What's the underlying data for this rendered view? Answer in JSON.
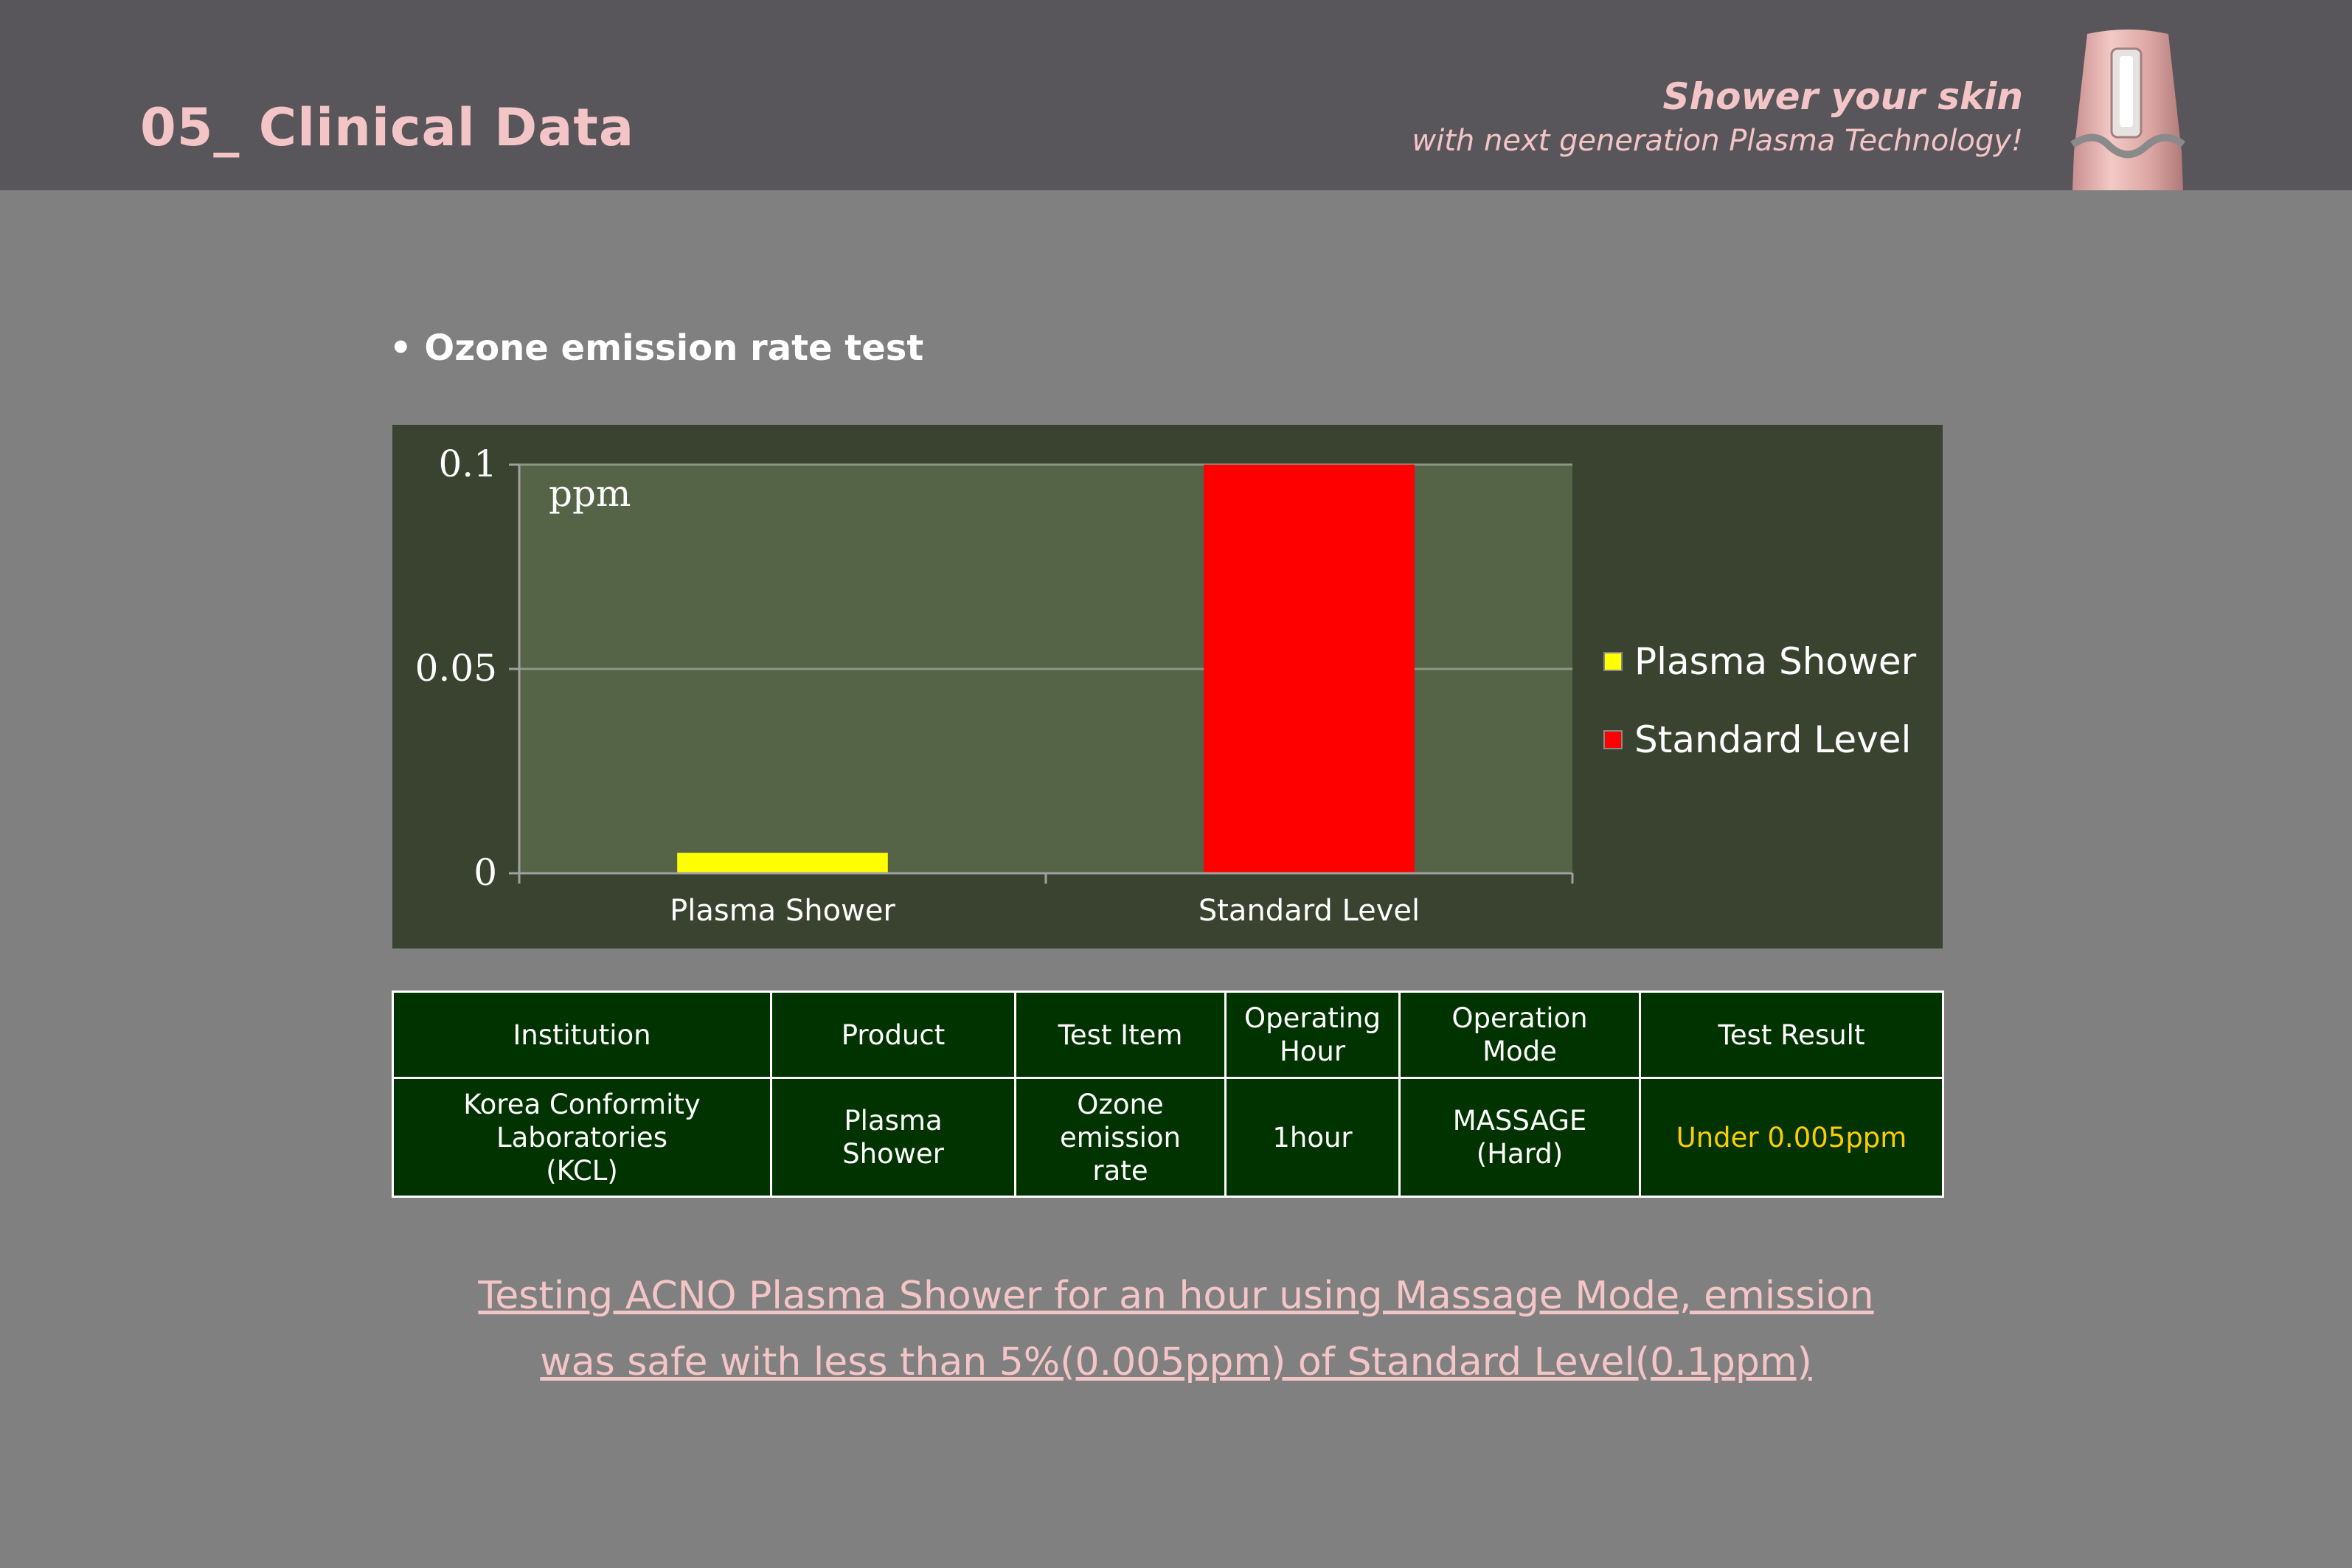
{
  "header": {
    "title": "05_ Clinical Data",
    "tagline_main": "Shower your skin",
    "tagline_sub": "with next generation Plasma Technology!"
  },
  "section_title": "• Ozone emission rate test",
  "chart_data": {
    "type": "bar",
    "categories": [
      "Plasma Shower",
      "Standard Level"
    ],
    "values": [
      0.005,
      0.1
    ],
    "colors": [
      "#ffff00",
      "#ff0000"
    ],
    "yticks": [
      "0",
      "0.05",
      "0.1"
    ],
    "ylim": [
      0,
      0.1
    ],
    "unit_label": "ppm",
    "legend": [
      "Plasma Shower",
      "Standard Level"
    ],
    "legend_position": "right",
    "grid": true
  },
  "table": {
    "headers": [
      "Institution",
      "Product",
      "Test Item",
      "Operating\nHour",
      "Operation\nMode",
      "Test Result"
    ],
    "rows": [
      [
        "Korea Conformity\nLaboratories\n(KCL)",
        "Plasma\nShower",
        "Ozone\nemission\nrate",
        "1hour",
        "MASSAGE\n(Hard)",
        "Under 0.005ppm"
      ]
    ]
  },
  "conclusion": {
    "line1": "Testing ACNO Plasma Shower for an hour using Massage Mode, emission",
    "line2": "was safe with less than 5%(0.005ppm) of Standard Level(0.1ppm)"
  },
  "colors": {
    "header_bg": "#58565a",
    "accent_pink": "#f4c5c6",
    "plot_bg": "#556346",
    "panel_bg": "#3a4330",
    "table_bg": "#003300",
    "result_text": "#ffcc00"
  }
}
